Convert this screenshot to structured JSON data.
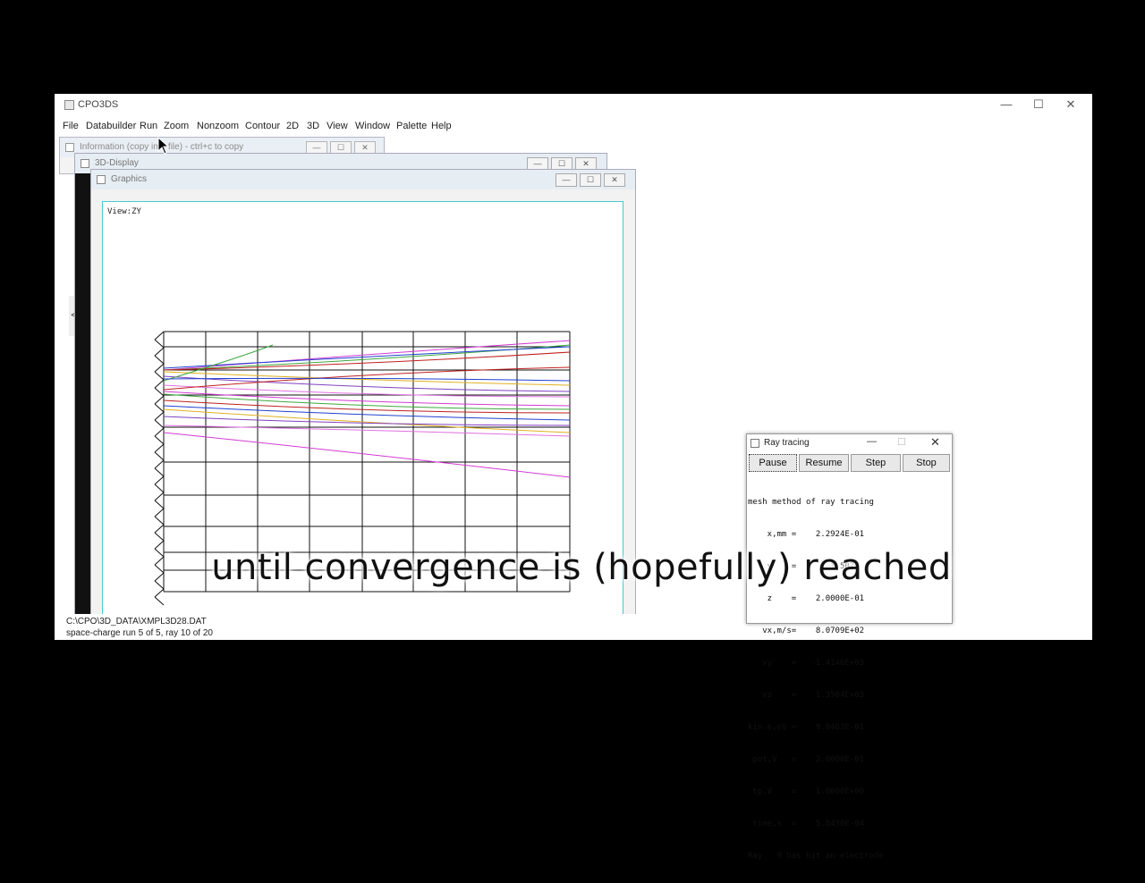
{
  "window": {
    "title": "CPO3DS",
    "minimize": "—",
    "maximize": "☐",
    "close": "✕"
  },
  "menu": [
    "File",
    "Databuilder",
    "Run",
    "Zoom",
    "Nonzoom",
    "Contour",
    "2D",
    "3D",
    "View",
    "Window",
    "Palette",
    "Help"
  ],
  "children": {
    "info_title": "Information (copy into file) - ctrl+c to copy",
    "display_title": "3D-Display",
    "graphics_title": "Graphics",
    "view_label": "View:ZY"
  },
  "ray_window": {
    "title": "Ray tracing",
    "buttons": [
      "Pause",
      "Resume",
      "Step",
      "Stop"
    ],
    "lines": [
      "mesh method of ray tracing",
      "    x,mm =    2.2924E-01",
      "    y    =       1.5070",
      "    z    =    2.0000E-01",
      "   vx,m/s=    8.0709E+02",
      "   vy    =   -1.4146E+03",
      "   vz    =    1.3504E+03",
      "kin.e,eV =    9.0463E-01",
      " pot,V   =    2.0000E-01",
      " tp,V    =    1.0000E+00",
      " time,s  =    5.8430E-04",
      "Ray   9 has hit an electrode"
    ]
  },
  "status": {
    "file": "C:\\CPO\\3D_DATA\\XMPL3D28.DAT",
    "run": "space-charge run  5 of  5, ray 10 of 20"
  },
  "caption": "until convergence is (hopefully) reached",
  "colors": {
    "ray_colors": [
      "#d23bd2",
      "#3fa83f",
      "#c02020",
      "#2040d0",
      "#e0b020",
      "#8040c0",
      "#e070e0"
    ]
  }
}
